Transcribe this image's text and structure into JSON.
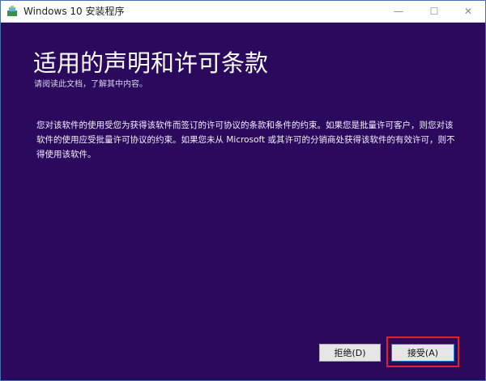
{
  "window": {
    "title": "Windows 10 安装程序",
    "controls": {
      "minimize": "—",
      "maximize": "☐",
      "close": "✕"
    }
  },
  "page": {
    "heading": "适用的声明和许可条款",
    "subtitle": "请阅读此文档，了解其中内容。",
    "body": "您对该软件的使用受您为获得该软件而签订的许可协议的条款和条件的约束。如果您是批量许可客户，则您对该软件的使用应受批量许可协议的约束。如果您未从 Microsoft 或其许可的分销商处获得该软件的有效许可，则不得使用该软件。"
  },
  "buttons": {
    "decline": "拒绝(D)",
    "accept": "接受(A)"
  },
  "colors": {
    "background": "#2b0a5e",
    "highlight": "#e0232b",
    "accept_border": "#1979ca"
  },
  "icons": {
    "app": "setup-app-icon"
  }
}
